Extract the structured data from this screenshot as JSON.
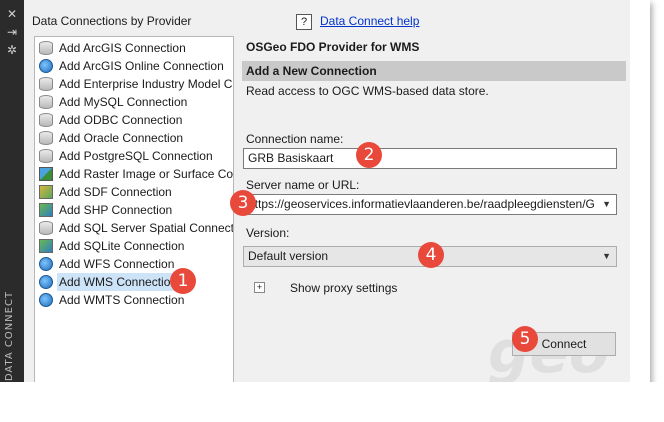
{
  "sidebar_strip": {
    "title": "DATA CONNECT"
  },
  "left_panel": {
    "header": "Data Connections by Provider",
    "items": [
      {
        "label": "Add ArcGIS Connection",
        "icon": "database-icon"
      },
      {
        "label": "Add ArcGIS Online Connection",
        "icon": "globe-icon"
      },
      {
        "label": "Add Enterprise Industry Model C",
        "icon": "database-icon"
      },
      {
        "label": "Add MySQL Connection",
        "icon": "database-icon"
      },
      {
        "label": "Add ODBC Connection",
        "icon": "database-icon"
      },
      {
        "label": "Add Oracle Connection",
        "icon": "database-icon"
      },
      {
        "label": "Add PostgreSQL Connection",
        "icon": "database-icon"
      },
      {
        "label": "Add Raster Image or Surface Co",
        "icon": "raster-icon"
      },
      {
        "label": "Add SDF Connection",
        "icon": "sdf-icon"
      },
      {
        "label": "Add SHP Connection",
        "icon": "shp-icon"
      },
      {
        "label": "Add SQL Server Spatial Connect",
        "icon": "database-icon"
      },
      {
        "label": "Add SQLite Connection",
        "icon": "shp-icon"
      },
      {
        "label": "Add WFS Connection",
        "icon": "globe-icon"
      },
      {
        "label": "Add WMS Connection",
        "icon": "globe-icon",
        "selected": true
      },
      {
        "label": "Add WMTS Connection",
        "icon": "globe-icon"
      }
    ]
  },
  "right_panel": {
    "help_icon": "?",
    "help_link": "Data Connect help",
    "provider_title": "OSGeo FDO Provider for WMS",
    "section_title": "Add a New Connection",
    "description": "Read access to OGC WMS-based data store.",
    "connection_name_label": "Connection name:",
    "connection_name_value": "GRB Basiskaart",
    "server_label": "Server name or URL:",
    "server_value": "https://geoservices.informatievlaanderen.be/raadpleegdiensten/G",
    "version_label": "Version:",
    "version_value": "Default version",
    "proxy_expander": "+",
    "proxy_label": "Show proxy settings",
    "connect_button": "Connect"
  },
  "callouts": [
    "1",
    "2",
    "3",
    "4",
    "5"
  ],
  "watermark": "geo",
  "colors": {
    "callout": "#e8493b",
    "section_bar": "#c9c9c9",
    "link": "#0033cc",
    "selection": "#cde3f7",
    "strip": "#2b2b2b"
  }
}
